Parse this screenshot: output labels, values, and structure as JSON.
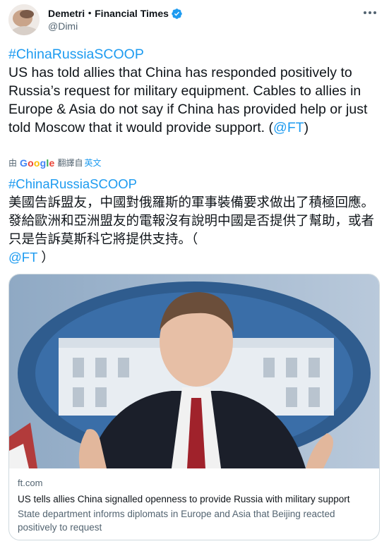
{
  "author": {
    "display_name": "Demetri・Financial Times",
    "handle": "@Dimi",
    "verified": true
  },
  "tweet": {
    "hashtag": "#ChinaRussiaSCOOP",
    "body": "US has told allies that China has responded positively to Russia’s request for military equipment. Cables to allies in Europe & Asia do not say if China has provided help or just told Moscow that it would provide support.",
    "mention_prefix": "(",
    "mention": "@FT",
    "mention_suffix": ")"
  },
  "translation": {
    "by_label": "由",
    "provider": "Google",
    "from_label": "翻譯自",
    "source_lang": "英文"
  },
  "translated": {
    "hashtag": "#ChinaRussiaSCOOP",
    "body": "美國告訴盟友，中國對俄羅斯的軍事裝備要求做出了積極回應。發給歐洲和亞洲盟友的電報沒有說明中國是否提供了幫助，或者只是告訴莫斯科它將提供支持。（",
    "mention": "@FT",
    "mention_suffix": "）"
  },
  "card": {
    "domain": "ft.com",
    "title": "US tells allies China signalled openness to provide Russia with military support",
    "description": "State department informs diplomats in Europe and Asia that Beijing reacted positively to request"
  },
  "icons": {
    "verified": "verified-badge-icon",
    "more": "more-options-icon"
  },
  "colors": {
    "accent": "#1d9bf0",
    "text": "#0f1419",
    "muted": "#536471"
  }
}
